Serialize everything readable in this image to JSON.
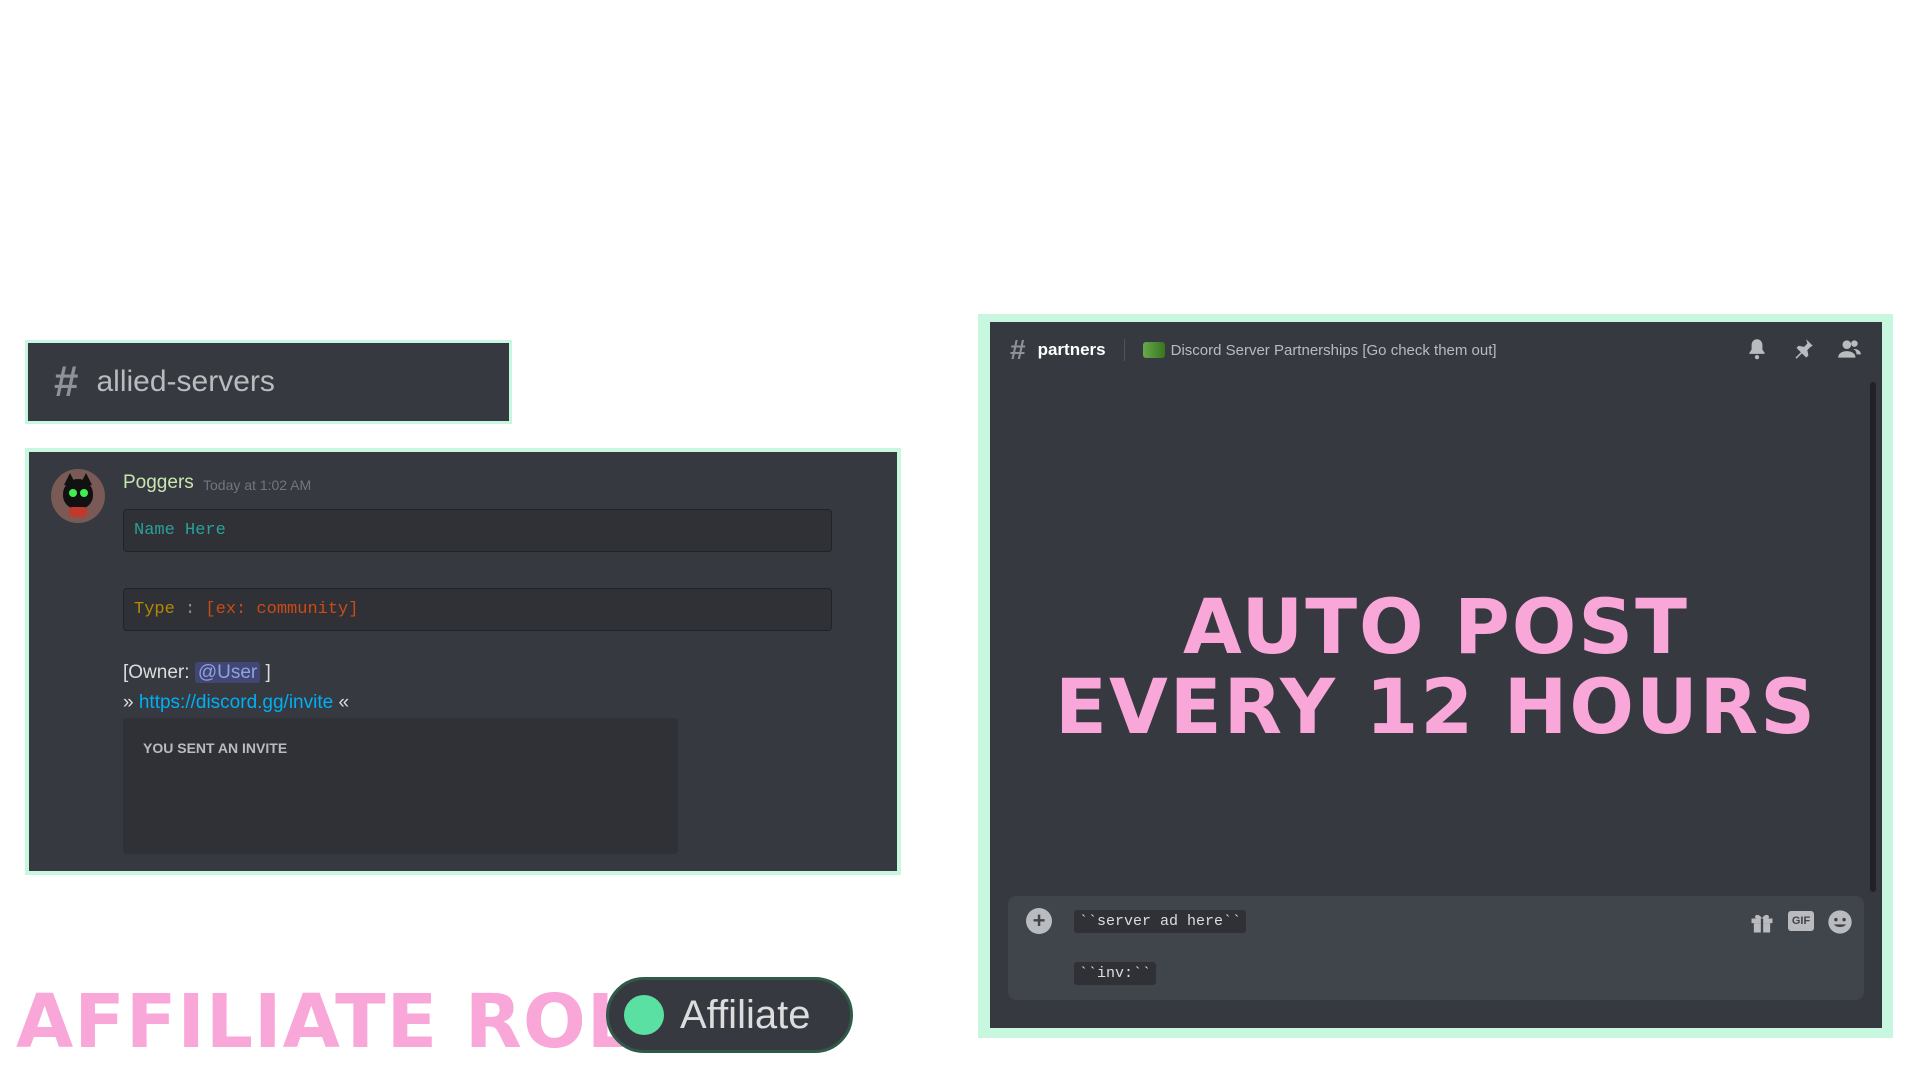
{
  "channel_card": {
    "hash": "#",
    "name": "allied-servers"
  },
  "message": {
    "username": "Poggers",
    "timestamp": "Today at 1:02 AM",
    "code_name": "Name Here",
    "code_type_key": "Type",
    "code_type_sep": " : ",
    "code_type_value": "[ex: community]",
    "owner_prefix": "[Owner: ",
    "owner_mention": "@User",
    "owner_suffix": " ]",
    "invite_prefix": "» ",
    "invite_link": "https://discord.gg/invite",
    "invite_suffix": " «",
    "embed_label": "YOU SENT AN INVITE"
  },
  "affiliate": {
    "title": "AFFILIATE ROLE",
    "pill_label": "Affiliate"
  },
  "right_panel": {
    "hash": "#",
    "channel": "partners",
    "topic": "Discord Server Partnerships [Go check them out]",
    "headline_line1": "AUTO POST",
    "headline_line2": "EVERY 12 HOURS",
    "composer_line1": "``server ad here``",
    "composer_line2": "``inv:``",
    "gif_label": "GIF",
    "plus": "+"
  },
  "colors": {
    "accent_pink": "#f9a6d9",
    "border_mint": "#c7f7de",
    "discord_bg": "#36393f",
    "affiliate_dot": "#5be0a3",
    "link": "#00aff4"
  },
  "icons": [
    "hash-icon",
    "bell-icon",
    "pin-icon",
    "members-icon",
    "plus-icon",
    "gift-icon",
    "gif-icon",
    "emoji-icon"
  ]
}
